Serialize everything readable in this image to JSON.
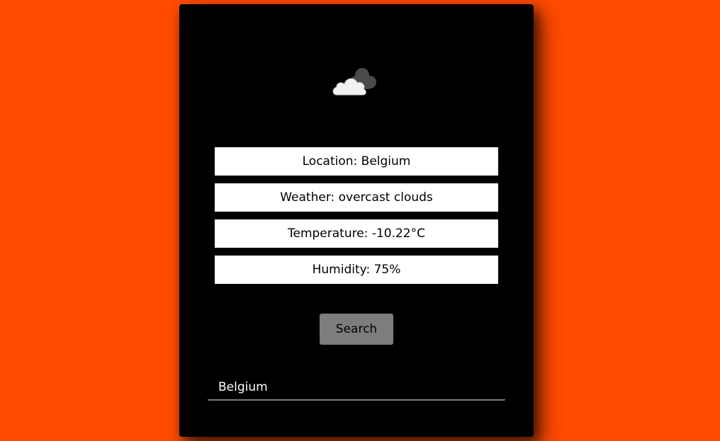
{
  "weather": {
    "icon": "cloud-icon",
    "location_label": "Location: Belgium",
    "weather_label": "Weather: overcast clouds",
    "temperature_label": "Temperature: -10.22°C",
    "humidity_label": "Humidity: 75%"
  },
  "search": {
    "button_label": "Search",
    "input_value": "Belgium"
  },
  "colors": {
    "background": "#ff4a00",
    "card": "#000000",
    "info_box": "#ffffff",
    "button": "#7d7d7d"
  }
}
